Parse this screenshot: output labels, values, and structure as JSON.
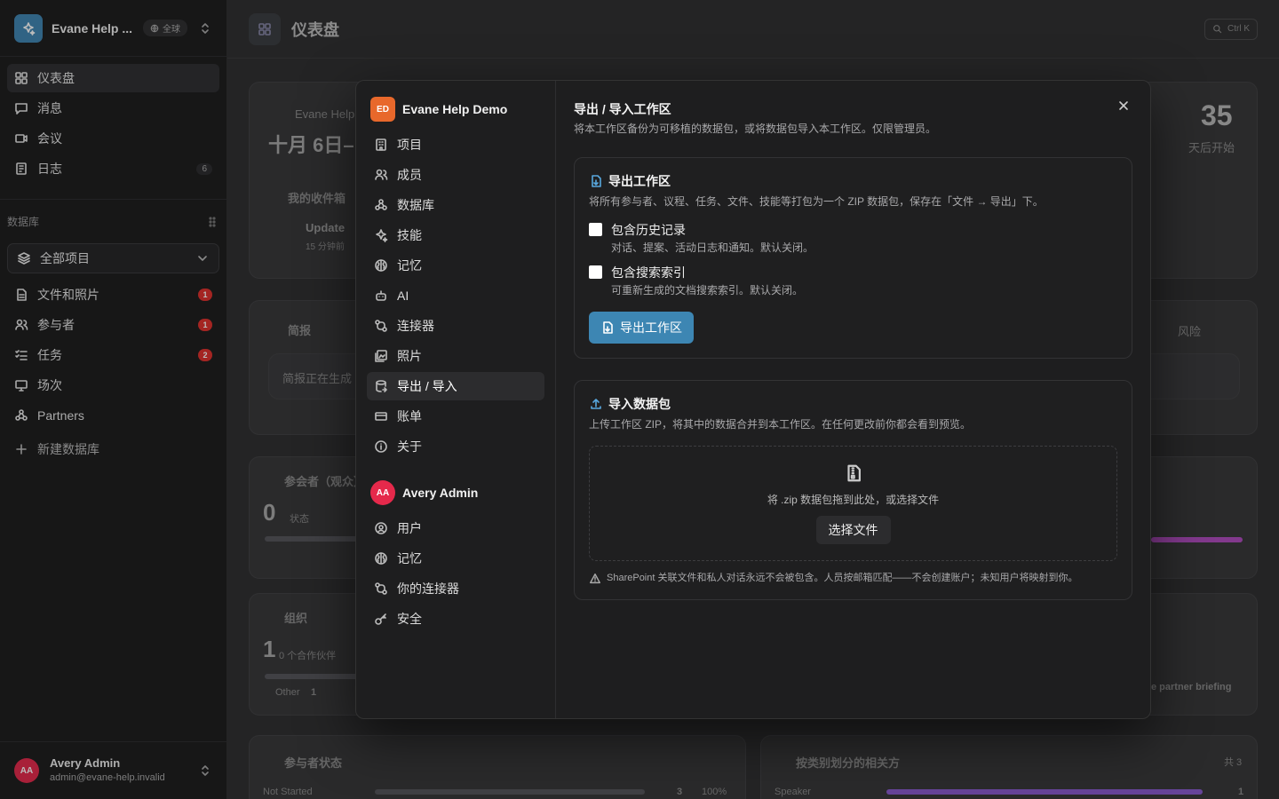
{
  "sidebar": {
    "workspace_name": "Evane Help ...",
    "workspace_scope": "全球",
    "nav": [
      {
        "label": "仪表盘"
      },
      {
        "label": "消息"
      },
      {
        "label": "会议"
      },
      {
        "label": "日志",
        "count": "6"
      }
    ],
    "section_title": "数据库",
    "project_select": "全部项目",
    "db_items": [
      {
        "label": "文件和照片",
        "badge": "1"
      },
      {
        "label": "参与者",
        "badge": "1"
      },
      {
        "label": "任务",
        "badge": "2"
      },
      {
        "label": "场次"
      },
      {
        "label": "Partners"
      }
    ],
    "new_db": "新建数据库",
    "user": {
      "initials": "AA",
      "name": "Avery Admin",
      "email": "admin@evane-help.invalid"
    }
  },
  "main": {
    "title": "仪表盘",
    "search_shortcut": "Ctrl K",
    "bg": {
      "event_label": "Evane Help",
      "event_date": "十月 6日–",
      "inbox": "我的收件箱",
      "update": "Update",
      "update_time": "15 分钟前",
      "countdown": "35",
      "countdown_label": "天后开始",
      "brief": "简报",
      "brief_status": "简报正在生成",
      "brief_tab_1": "风险",
      "participants": "参会者（观众）",
      "participants_count": "0",
      "participants_sub": "状态",
      "org": "组织",
      "org_count": "1",
      "org_sub": "0 个合作伙伴",
      "org_other": "Other",
      "org_other_count": "1",
      "partner_briefing": "e partner briefing",
      "status_title": "参与者状态",
      "status_row": "Not Started",
      "status_count": "3",
      "status_pct": "100%",
      "stakeholders_title": "按类别划分的相关方",
      "stakeholders_total": "共 3",
      "speaker": "Speaker",
      "speaker_count": "1"
    }
  },
  "modal": {
    "workspace_initials": "ED",
    "workspace_name": "Evane Help Demo",
    "workspace_nav": [
      {
        "label": "项目",
        "icon": "building-icon"
      },
      {
        "label": "成员",
        "icon": "users-icon"
      },
      {
        "label": "数据库",
        "icon": "database-icon"
      },
      {
        "label": "技能",
        "icon": "sparkle-icon"
      },
      {
        "label": "记忆",
        "icon": "brain-icon"
      },
      {
        "label": "AI",
        "icon": "bot-icon"
      },
      {
        "label": "连接器",
        "icon": "connector-icon"
      },
      {
        "label": "照片",
        "icon": "photo-icon"
      },
      {
        "label": "导出 / 导入",
        "icon": "export-import-icon"
      },
      {
        "label": "账单",
        "icon": "card-icon"
      },
      {
        "label": "关于",
        "icon": "info-icon"
      }
    ],
    "user_initials": "AA",
    "user_name": "Avery Admin",
    "user_nav": [
      {
        "label": "用户",
        "icon": "user-circle-icon"
      },
      {
        "label": "记忆",
        "icon": "brain-icon"
      },
      {
        "label": "你的连接器",
        "icon": "connector-icon"
      },
      {
        "label": "安全",
        "icon": "key-icon"
      }
    ],
    "title": "导出 / 导入工作区",
    "description": "将本工作区备份为可移植的数据包，或将数据包导入本工作区。仅限管理员。",
    "export": {
      "title": "导出工作区",
      "description": "将所有参与者、议程、任务、文件、技能等打包为一个 ZIP 数据包，保存在「文件 → 导出」下。",
      "opt_history_label": "包含历史记录",
      "opt_history_desc": "对话、提案、活动日志和通知。默认关闭。",
      "opt_history_checked": false,
      "opt_index_label": "包含搜索索引",
      "opt_index_desc": "可重新生成的文档搜索索引。默认关闭。",
      "opt_index_checked": false,
      "button": "导出工作区"
    },
    "import": {
      "title": "导入数据包",
      "description": "上传工作区 ZIP，将其中的数据合并到本工作区。在任何更改前你都会看到预览。",
      "drop_text": "将 .zip 数据包拖到此处，或选择文件",
      "button": "选择文件",
      "note": "SharePoint 关联文件和私人对话永远不会被包含。人员按邮箱匹配——不会创建账户；未知用户将映射到你。"
    }
  },
  "colors": {
    "accent": "#3d86b3",
    "badge_red": "#e0302c",
    "avatar": "#e5294b",
    "workspace_logo": "#e8682b"
  }
}
